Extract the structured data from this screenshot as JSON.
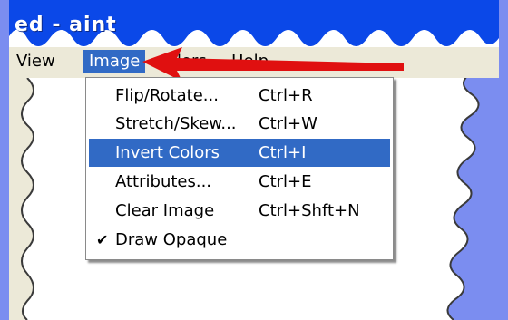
{
  "window": {
    "title": "ed - aint"
  },
  "menubar": {
    "items": [
      {
        "label": "View"
      },
      {
        "label": "Image"
      },
      {
        "label": "olors"
      },
      {
        "label": "Help"
      }
    ]
  },
  "image_menu": {
    "items": [
      {
        "label": "Flip/Rotate...",
        "shortcut": "Ctrl+R"
      },
      {
        "label": "Stretch/Skew...",
        "shortcut": "Ctrl+W"
      },
      {
        "label": "Invert Colors",
        "shortcut": "Ctrl+I"
      },
      {
        "label": "Attributes...",
        "shortcut": "Ctrl+E"
      },
      {
        "label": "Clear Image",
        "shortcut": "Ctrl+Shft+N"
      },
      {
        "label": "Draw Opaque",
        "shortcut": ""
      }
    ]
  },
  "colors": {
    "background": "#7b8df0",
    "titlebar": "#0b48e8",
    "highlight": "#316ac5",
    "arrow": "#e01010"
  }
}
